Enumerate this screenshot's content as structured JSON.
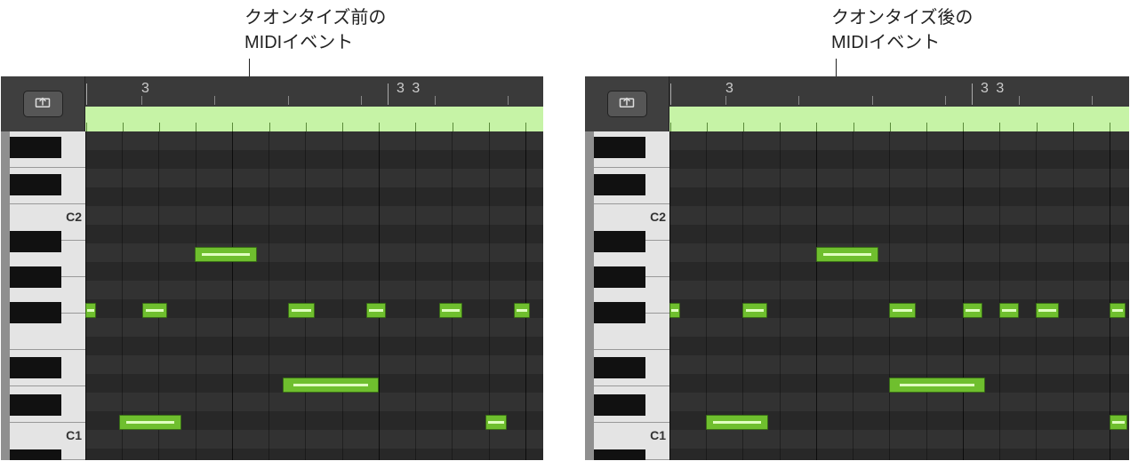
{
  "annotation_left": {
    "line1": "クオンタイズ前の",
    "line2": "MIDIイベント"
  },
  "annotation_right": {
    "line1": "クオンタイズ後の",
    "line2": "MIDIイベント"
  },
  "ruler": {
    "label_bar3": "3",
    "label_bar3_3": "3 3"
  },
  "keyboard": {
    "c1": "C1",
    "c2": "C2"
  },
  "icons": {
    "catch": "catch-playhead-icon"
  }
}
